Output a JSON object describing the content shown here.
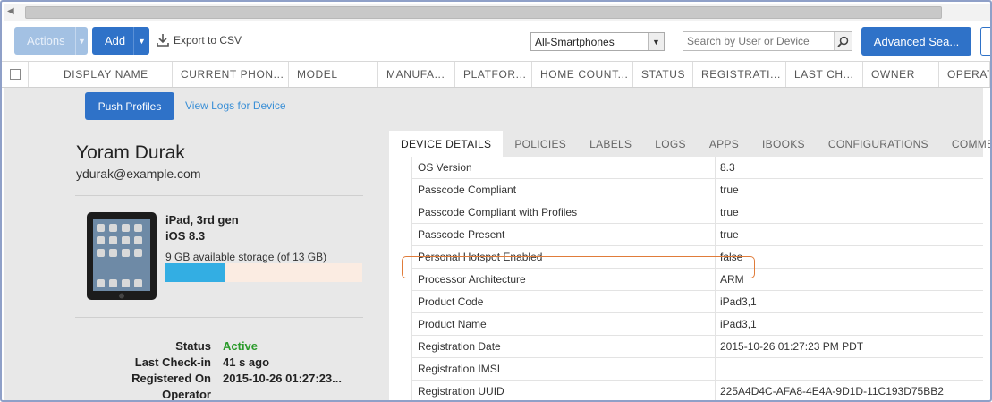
{
  "toolbar": {
    "actions_label": "Actions",
    "add_label": "Add",
    "export_label": "Export to CSV",
    "device_filter": "All-Smartphones",
    "search_placeholder": "Search by User or Device",
    "advanced_search_label": "Advanced Sea..."
  },
  "table": {
    "columns": [
      "DISPLAY NAME",
      "CURRENT PHON...",
      "MODEL",
      "MANUFA...",
      "PLATFOR...",
      "HOME COUNT...",
      "STATUS",
      "REGISTRATI...",
      "LAST CH...",
      "OWNER",
      "OPERAT"
    ]
  },
  "detail": {
    "push_profiles_label": "Push Profiles",
    "view_logs_label": "View Logs for Device",
    "user_name": "Yoram Durak",
    "user_email": "ydurak@example.com",
    "device_model": "iPad, 3rd gen",
    "device_os": "iOS 8.3",
    "storage_available": "9 GB",
    "storage_text": " available storage (of 13 GB)",
    "storage_used_fraction": 0.3,
    "status_label": "Status",
    "status_value": "Active",
    "last_checkin_label": "Last Check-in",
    "last_checkin_value": "41 s ago",
    "registered_on_label": "Registered On",
    "registered_on_value": "2015-10-26 01:27:23...",
    "operator_label": "Operator",
    "accent_color": "#2f72c8",
    "active_color": "#2b9b2b",
    "highlight_color": "#e07c3a"
  },
  "tabs": [
    "DEVICE DETAILS",
    "POLICIES",
    "LABELS",
    "LOGS",
    "APPS",
    "IBOOKS",
    "CONFIGURATIONS",
    "COMME"
  ],
  "device_details": [
    {
      "key": "OS Version",
      "value": "8.3"
    },
    {
      "key": "Passcode Compliant",
      "value": "true"
    },
    {
      "key": "Passcode Compliant with Profiles",
      "value": "true"
    },
    {
      "key": "Passcode Present",
      "value": "true"
    },
    {
      "key": "Personal Hotspot Enabled",
      "value": "false"
    },
    {
      "key": "Processor Architecture",
      "value": "ARM"
    },
    {
      "key": "Product Code",
      "value": "iPad3,1"
    },
    {
      "key": "Product Name",
      "value": "iPad3,1"
    },
    {
      "key": "Registration Date",
      "value": "2015-10-26 01:27:23 PM PDT"
    },
    {
      "key": "Registration IMSI",
      "value": ""
    },
    {
      "key": "Registration UUID",
      "value": "225A4D4C-AFA8-4E4A-9D1D-11C193D75BB2"
    }
  ]
}
